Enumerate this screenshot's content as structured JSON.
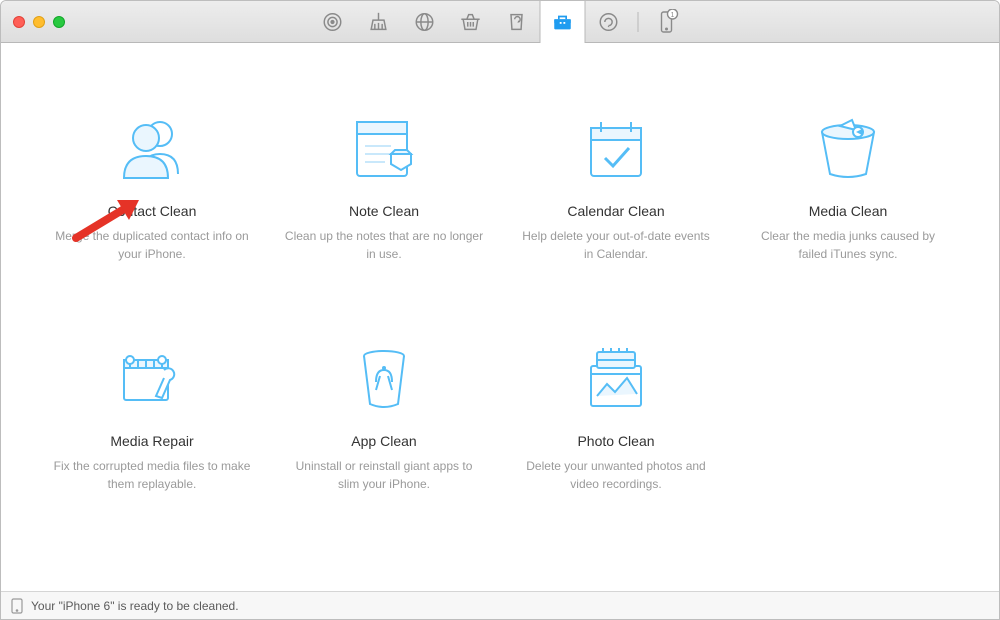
{
  "colors": {
    "accent": "#1f9cf0",
    "iconStroke": "#55bdf6",
    "text": "#333333",
    "muted": "#9a9a9a"
  },
  "toolbar": {
    "tabs": [
      {
        "name": "target-icon"
      },
      {
        "name": "broom-icon"
      },
      {
        "name": "globe-icon"
      },
      {
        "name": "basket-icon"
      },
      {
        "name": "recycle-icon"
      },
      {
        "name": "toolbox-icon",
        "active": true
      },
      {
        "name": "refresh-badge-icon"
      }
    ],
    "device": {
      "name": "phone-icon",
      "badge": "1"
    }
  },
  "cards": [
    {
      "icon": "contacts-icon",
      "title": "Contact Clean",
      "desc": "Merge the duplicated contact info on your iPhone."
    },
    {
      "icon": "note-icon",
      "title": "Note Clean",
      "desc": "Clean up the notes that are no longer in use."
    },
    {
      "icon": "calendar-icon",
      "title": "Calendar Clean",
      "desc": "Help delete your out-of-date events in Calendar."
    },
    {
      "icon": "media-bucket-icon",
      "title": "Media Clean",
      "desc": "Clear the media junks caused by failed iTunes sync."
    },
    {
      "icon": "media-repair-icon",
      "title": "Media Repair",
      "desc": "Fix the corrupted media files to make them replayable."
    },
    {
      "icon": "app-clean-icon",
      "title": "App Clean",
      "desc": "Uninstall or reinstall giant apps to slim your iPhone."
    },
    {
      "icon": "photo-clean-icon",
      "title": "Photo Clean",
      "desc": "Delete your unwanted photos and video recordings."
    }
  ],
  "status": {
    "text": "Your \"iPhone 6\" is ready to be cleaned."
  }
}
